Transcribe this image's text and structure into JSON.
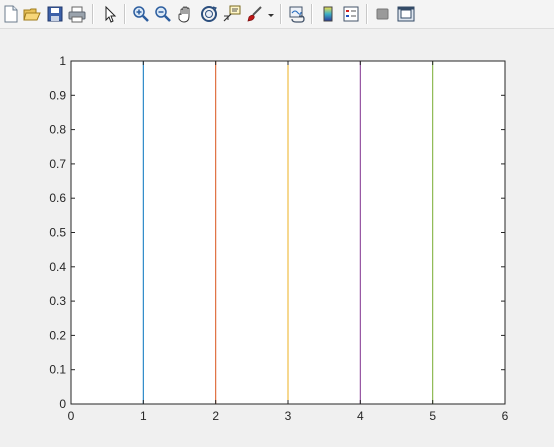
{
  "toolbar": {
    "icons": [
      "new-figure-icon",
      "open-file-icon",
      "save-icon",
      "print-icon",
      "select-arrow-icon",
      "zoom-in-icon",
      "zoom-out-icon",
      "pan-hand-icon",
      "rotate-3d-icon",
      "data-cursor-icon",
      "brush-icon",
      "brush-dropdown-icon",
      "link-plot-icon",
      "colorbar-icon",
      "legend-icon",
      "hide-plot-tools-icon",
      "show-plot-tools-icon"
    ]
  },
  "chart_data": {
    "type": "line",
    "title": "",
    "xlabel": "",
    "ylabel": "",
    "xlim": [
      0,
      6
    ],
    "ylim": [
      0,
      1
    ],
    "grid": false,
    "xticks": [
      "0",
      "1",
      "2",
      "3",
      "4",
      "5",
      "6"
    ],
    "yticks": [
      "0",
      "0.1",
      "0.2",
      "0.3",
      "0.4",
      "0.5",
      "0.6",
      "0.7",
      "0.8",
      "0.9",
      "1"
    ],
    "series": [
      {
        "x": [
          1,
          1
        ],
        "y": [
          0,
          1
        ],
        "color": "#0072bd"
      },
      {
        "x": [
          2,
          2
        ],
        "y": [
          0,
          1
        ],
        "color": "#d95319"
      },
      {
        "x": [
          3,
          3
        ],
        "y": [
          0,
          1
        ],
        "color": "#edb120"
      },
      {
        "x": [
          4,
          4
        ],
        "y": [
          0,
          1
        ],
        "color": "#7e2f8e"
      },
      {
        "x": [
          5,
          5
        ],
        "y": [
          0,
          1
        ],
        "color": "#77ac30"
      }
    ]
  }
}
